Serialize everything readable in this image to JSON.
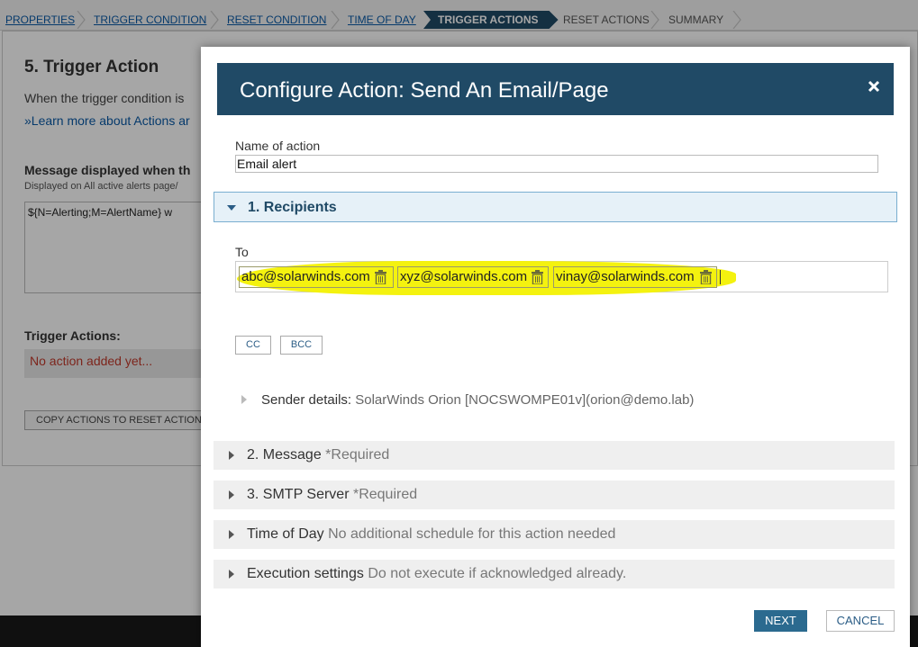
{
  "wizard": {
    "steps": [
      {
        "label": "PROPERTIES"
      },
      {
        "label": "TRIGGER CONDITION"
      },
      {
        "label": "RESET CONDITION"
      },
      {
        "label": "TIME OF DAY"
      },
      {
        "label": "TRIGGER ACTIONS"
      },
      {
        "label": "RESET ACTIONS"
      },
      {
        "label": "SUMMARY"
      }
    ],
    "active_index": 4
  },
  "background": {
    "title": "5. Trigger Action",
    "description": "When the trigger condition is",
    "learn_more_link": "»Learn more about Actions ar",
    "message_label": "Message displayed when th",
    "message_sublabel": "Displayed on All active alerts page/",
    "message_value": "${N=Alerting;M=AlertName} w",
    "trigger_actions_label": "Trigger Actions:",
    "no_action_text": "No action added yet...",
    "copy_button": "COPY ACTIONS TO RESET ACTIONS T"
  },
  "modal": {
    "title": "Configure Action: Send An Email/Page",
    "name_label": "Name of action",
    "name_value": "Email alert",
    "recipients_section": "1. Recipients",
    "to_label": "To",
    "recipients": [
      "abc@solarwinds.com",
      "xyz@solarwinds.com",
      "vinay@solarwinds.com"
    ],
    "cc_button": "CC",
    "bcc_button": "BCC",
    "sender_label": "Sender details:",
    "sender_value": "SolarWinds Orion [NOCSWOMPE01v](orion@demo.lab)",
    "sections": [
      {
        "title": "2. Message",
        "subtitle": "*Required"
      },
      {
        "title": "3. SMTP Server",
        "subtitle": "*Required"
      },
      {
        "title": "Time of Day",
        "subtitle": "No additional schedule for this action needed"
      },
      {
        "title": "Execution settings",
        "subtitle": "Do not execute if acknowledged already."
      }
    ],
    "next_button": "NEXT",
    "cancel_button": "CANCEL"
  },
  "colors": {
    "header_bg": "#204a66",
    "highlight": "#f4f20f",
    "error_text": "#c0392b",
    "link": "#0a5aa6"
  }
}
